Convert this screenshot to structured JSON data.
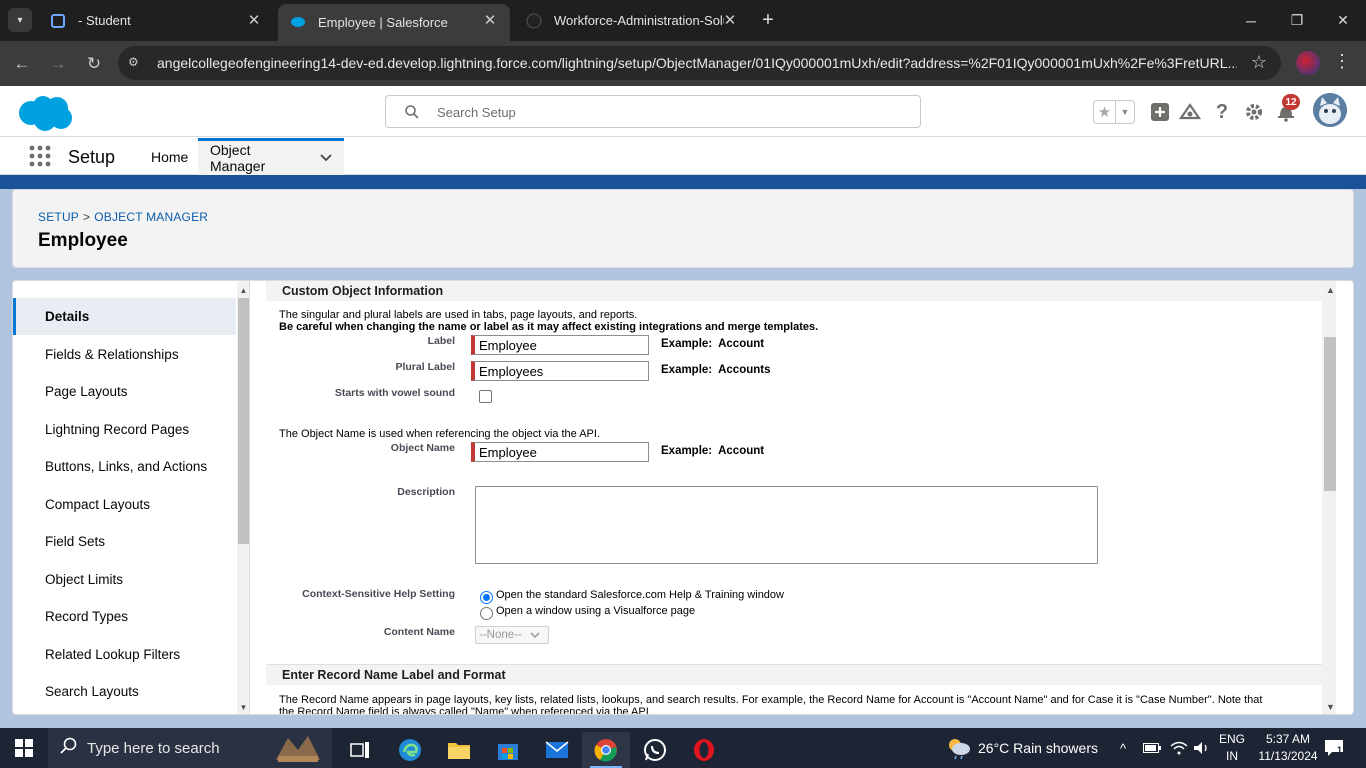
{
  "browser": {
    "tabs": [
      {
        "title": "- Student"
      },
      {
        "title": "Employee | Salesforce"
      },
      {
        "title": "Workforce-Administration-Solu"
      }
    ],
    "url": "angelcollegeofengineering14-dev-ed.develop.lightning.force.com/lightning/setup/ObjectManager/01IQy000001mUxh/edit?address=%2F01IQy000001mUxh%2Fe%3FretURL..."
  },
  "header": {
    "search_placeholder": "Search Setup",
    "notification_count": "12"
  },
  "nav": {
    "app_name": "Setup",
    "items": [
      {
        "label": "Home"
      },
      {
        "label": "Object Manager"
      }
    ]
  },
  "page": {
    "breadcrumb": [
      "SETUP",
      "OBJECT MANAGER"
    ],
    "breadcrumb_sep": ">",
    "title": "Employee"
  },
  "sidebar": {
    "items": [
      {
        "label": "Details"
      },
      {
        "label": "Fields & Relationships"
      },
      {
        "label": "Page Layouts"
      },
      {
        "label": "Lightning Record Pages"
      },
      {
        "label": "Buttons, Links, and Actions"
      },
      {
        "label": "Compact Layouts"
      },
      {
        "label": "Field Sets"
      },
      {
        "label": "Object Limits"
      },
      {
        "label": "Record Types"
      },
      {
        "label": "Related Lookup Filters"
      },
      {
        "label": "Search Layouts"
      }
    ]
  },
  "form": {
    "section1_title": "Custom Object Information",
    "intro_line1": "The singular and plural labels are used in tabs, page layouts, and reports.",
    "intro_line2": "Be careful when changing the name or label as it may affect existing integrations and merge templates.",
    "label_field": {
      "label": "Label",
      "value": "Employee",
      "example_prefix": "Example:",
      "example": "Account"
    },
    "plural_field": {
      "label": "Plural Label",
      "value": "Employees",
      "example_prefix": "Example:",
      "example": "Accounts"
    },
    "vowel_label": "Starts with vowel sound",
    "object_name_note": "The Object Name is used when referencing the object via the API.",
    "object_name_field": {
      "label": "Object Name",
      "value": "Employee",
      "example_prefix": "Example:",
      "example": "Account"
    },
    "description_label": "Description",
    "help_setting_label": "Context-Sensitive Help Setting",
    "help_option1": "Open the standard Salesforce.com Help & Training window",
    "help_option2": "Open a window using a Visualforce page",
    "content_name_label": "Content Name",
    "content_name_value": "--None--",
    "section2_title": "Enter Record Name Label and Format",
    "record_name_note1": "The Record Name appears in page layouts, key lists, related lists, lookups, and search results. For example, the Record Name for Account is \"Account Name\" and for Case it is \"Case Number\". Note that",
    "record_name_note2": "the Record Name field is always called \"Name\" when referenced via the API."
  },
  "taskbar": {
    "search_text": "Type here to search",
    "weather": "26°C  Rain showers",
    "lang1": "ENG",
    "lang2": "IN",
    "time": "5:37 AM",
    "date": "11/13/2024",
    "notif_count": "1"
  }
}
